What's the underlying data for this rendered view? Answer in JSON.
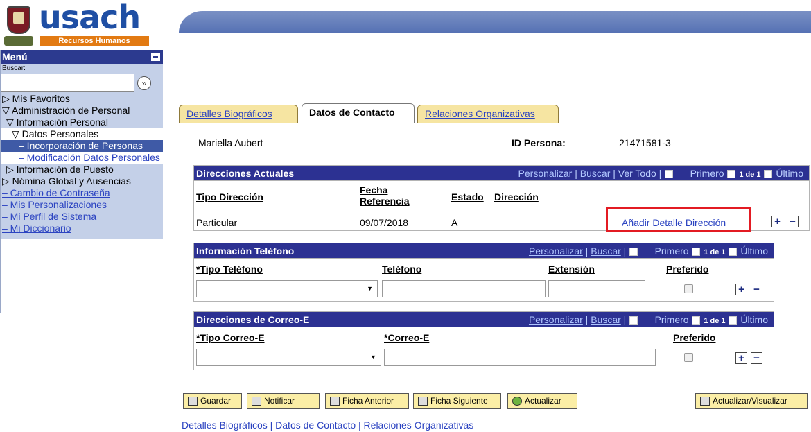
{
  "logo": {
    "word": "usach",
    "tagline": "Recursos Humanos"
  },
  "menu": {
    "title": "Menú",
    "search_label": "Buscar:",
    "search_value": "",
    "items": [
      {
        "label": "▷ Mis Favoritos"
      },
      {
        "label": "▽ Administración de Personal"
      },
      {
        "label": "▽ Información Personal"
      },
      {
        "label": "▽ Datos Personales"
      },
      {
        "label": "– Incorporación de Personas"
      },
      {
        "label": "– Modificación Datos Personales"
      },
      {
        "label": "▷ Información de Puesto"
      },
      {
        "label": "▷ Nómina Global y Ausencias"
      },
      {
        "label": "– Cambio de Contraseña"
      },
      {
        "label": "– Mis Personalizaciones"
      },
      {
        "label": "– Mi Perfil de Sistema"
      },
      {
        "label": "– Mi Diccionario"
      }
    ]
  },
  "tabs": [
    "Detalles Biográficos",
    "Datos de Contacto",
    "Relaciones Organizativas"
  ],
  "person": {
    "name": "Mariella Aubert",
    "id_label": "ID Persona:",
    "id_value": "21471581-3"
  },
  "grid_nav": {
    "personalizar": "Personalizar",
    "buscar": "Buscar",
    "ver_todo": "Ver Todo",
    "primero": "Primero",
    "count": "1 de 1",
    "ultimo": "Último"
  },
  "addresses": {
    "title": "Direcciones Actuales",
    "headers": {
      "tipo": "Tipo Dirección",
      "fecha": "Fecha Referencia",
      "estado": "Estado",
      "direccion": "Dirección"
    },
    "row": {
      "tipo": "Particular",
      "fecha": "09/07/2018",
      "estado": "A",
      "link": "Añadir Detalle Dirección"
    }
  },
  "phones": {
    "title": "Información Teléfono",
    "headers": {
      "tipo": "*Tipo Teléfono",
      "telefono": "Teléfono",
      "extension": "Extensión",
      "preferido": "Preferido"
    }
  },
  "emails": {
    "title": "Direcciones de Correo-E",
    "headers": {
      "tipo": "*Tipo Correo-E",
      "correo": "*Correo-E",
      "preferido": "Preferido"
    }
  },
  "buttons": {
    "guardar": "Guardar",
    "notificar": "Notificar",
    "anterior": "Ficha Anterior",
    "siguiente": "Ficha Siguiente",
    "actualizar": "Actualizar",
    "visualizar": "Actualizar/Visualizar"
  },
  "footer": {
    "l1": "Detalles Biográficos",
    "l2": "Datos de Contacto",
    "l3": "Relaciones Organizativas",
    "sep": " | "
  }
}
